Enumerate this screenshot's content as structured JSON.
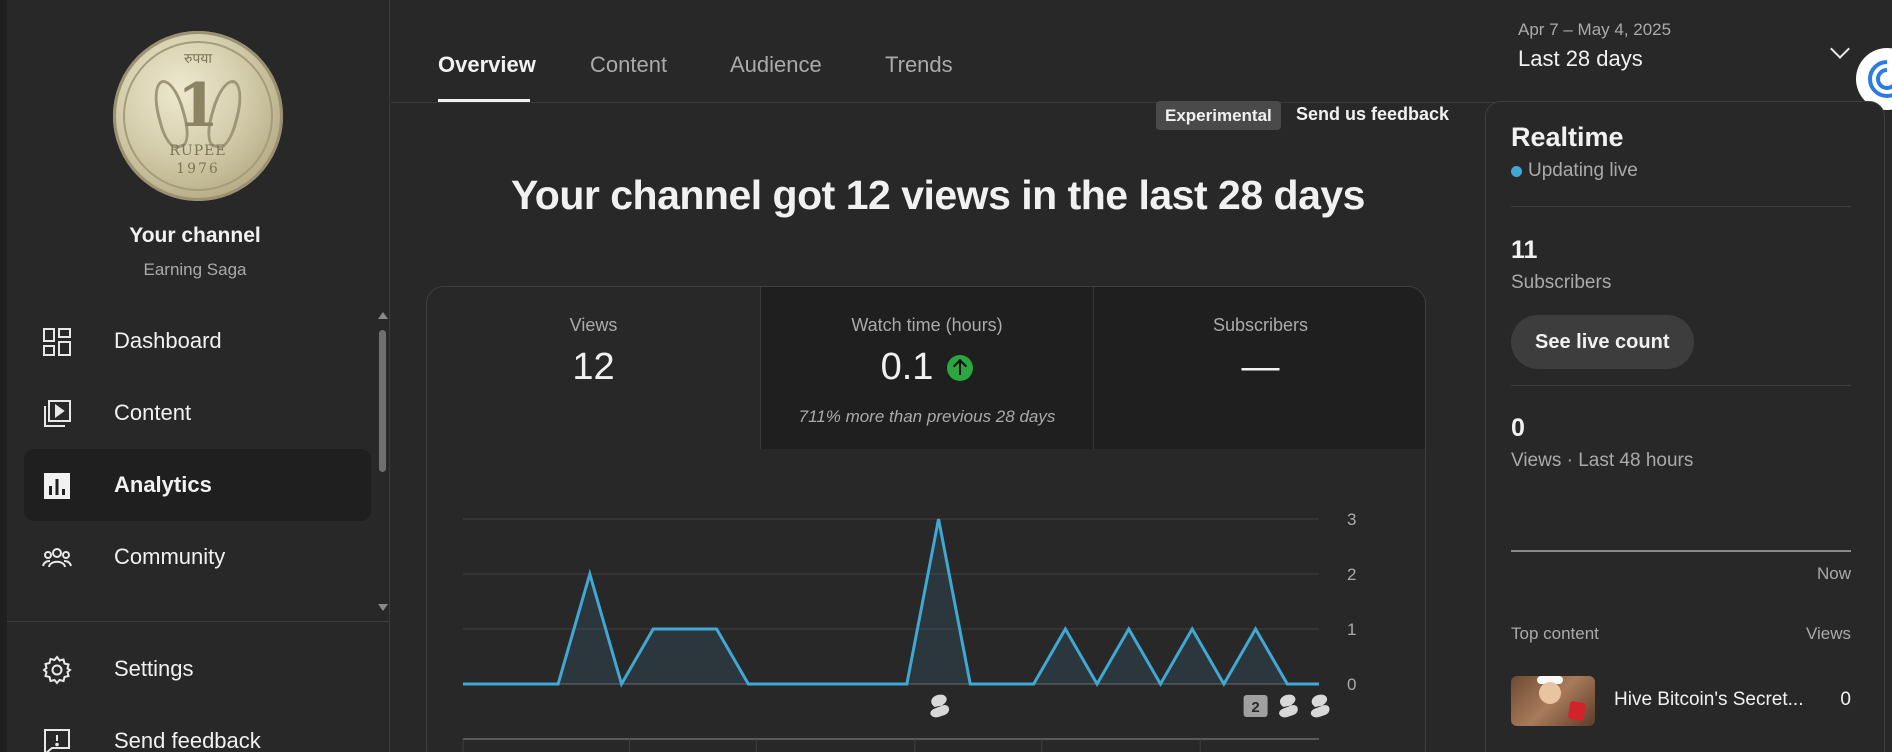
{
  "sidebar": {
    "channel_title": "Your channel",
    "channel_name": "Earning Saga",
    "avatar": {
      "coin_top": "रुपया",
      "coin_value": "1",
      "coin_unit": "RUPEE",
      "coin_year": "1976"
    },
    "items": [
      {
        "label": "Dashboard",
        "icon": "dashboard-icon"
      },
      {
        "label": "Content",
        "icon": "content-icon"
      },
      {
        "label": "Analytics",
        "icon": "analytics-icon",
        "active": true
      },
      {
        "label": "Community",
        "icon": "community-icon"
      }
    ],
    "bottom_items": [
      {
        "label": "Settings",
        "icon": "gear-icon"
      },
      {
        "label": "Send feedback",
        "icon": "feedback-icon"
      }
    ]
  },
  "tabs": [
    {
      "label": "Overview",
      "active": true
    },
    {
      "label": "Content"
    },
    {
      "label": "Audience"
    },
    {
      "label": "Trends"
    }
  ],
  "date_range": {
    "sub": "Apr 7 – May 4, 2025",
    "label": "Last 28 days"
  },
  "main": {
    "experimental_badge": "Experimental",
    "feedback_link": "Send us feedback",
    "headline": "Your channel got 12 views in the last 28 days",
    "metrics": [
      {
        "label": "Views",
        "value": "12",
        "note": ""
      },
      {
        "label": "Watch time (hours)",
        "value": "0.1",
        "note": "711% more than previous 28 days",
        "trend": "up"
      },
      {
        "label": "Subscribers",
        "value": "—",
        "note": ""
      }
    ]
  },
  "chart_data": {
    "type": "line",
    "title": "",
    "xlabel": "",
    "ylabel": "",
    "x": [
      1,
      2,
      3,
      4,
      5,
      6,
      7,
      8,
      9,
      10,
      11,
      12,
      13,
      14,
      15,
      16,
      17,
      18,
      19,
      20,
      21,
      22,
      23,
      24,
      25,
      26,
      27,
      28
    ],
    "series": [
      {
        "values": [
          0,
          0,
          0,
          0,
          2,
          0,
          1,
          1,
          1,
          0,
          0,
          0,
          0,
          0,
          0,
          3,
          0,
          0,
          0,
          1,
          0,
          1,
          0,
          1,
          0,
          1,
          0,
          0
        ]
      }
    ],
    "ylim": [
      0,
      3
    ],
    "yticks": [
      "0",
      "1",
      "2",
      "3"
    ],
    "grid": true,
    "color": "#41a8d4",
    "markers": [
      {
        "x": 16,
        "label": "",
        "icon": "shorts-icon"
      },
      {
        "x": 26,
        "label": "2",
        "icon": "badge"
      },
      {
        "x": 27,
        "label": "",
        "icon": "shorts-icon"
      },
      {
        "x": 28,
        "label": "",
        "icon": "shorts-icon"
      }
    ]
  },
  "realtime": {
    "title": "Realtime",
    "live_label": "Updating live",
    "subscribers_value": "11",
    "subscribers_label": "Subscribers",
    "live_count_button": "See live count",
    "views_value": "0",
    "views_label": "Views · Last 48 hours",
    "now_label": "Now",
    "top_content_label": "Top content",
    "top_content_views_label": "Views",
    "top_content": [
      {
        "title": "Hive Bitcoin's Secret...",
        "views": "0"
      }
    ]
  },
  "colors": {
    "background": "#282828",
    "panel_dark": "#1f1f1f",
    "accent_line": "#41a8d4",
    "up_green": "#2ba640"
  }
}
